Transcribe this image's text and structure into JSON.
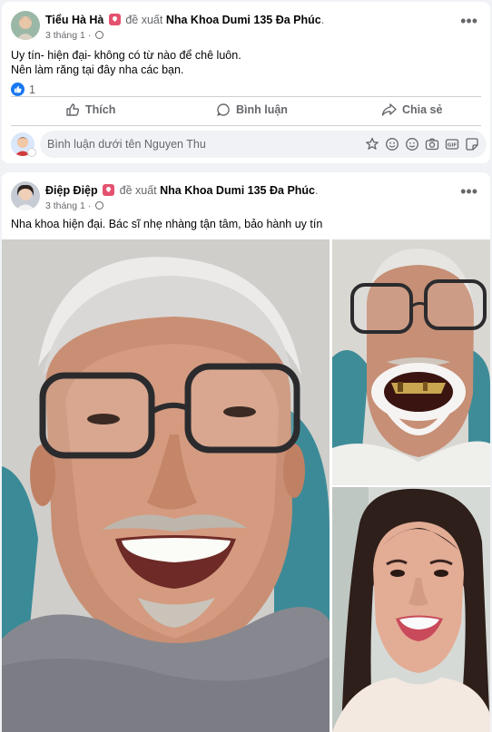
{
  "posts": [
    {
      "author": "Tiểu Hà Hà",
      "recommends": "đề xuất",
      "page": "Nha Khoa Dumi 135 Đa Phúc",
      "period": ".",
      "date": "3 tháng 1",
      "dot": "·",
      "lines": [
        "Uy tín- hiện đại- không có từ nào để chê luôn.",
        "Nên làm răng tại đây nha các bạn."
      ],
      "reaction_count": "1",
      "actions": {
        "like": "Thích",
        "comment": "Bình luận",
        "share": "Chia sẻ"
      },
      "comment_placeholder": "Bình luận dưới tên Nguyen Thu",
      "more": "•••"
    },
    {
      "author": "Điệp Điệp",
      "recommends": "đề xuất",
      "page": "Nha Khoa Dumi 135 Đa Phúc",
      "period": ".",
      "date": "3 tháng 1",
      "dot": "·",
      "lines": [
        "Nha khoa hiện đại. Bác sĩ nhẹ nhàng tận tâm, bảo hành uy tín"
      ],
      "more": "•••"
    }
  ],
  "colors": {
    "brand": "#1877f2",
    "muted": "#65676b",
    "badge": "#e4526f",
    "bg": "#f0f2f5"
  }
}
